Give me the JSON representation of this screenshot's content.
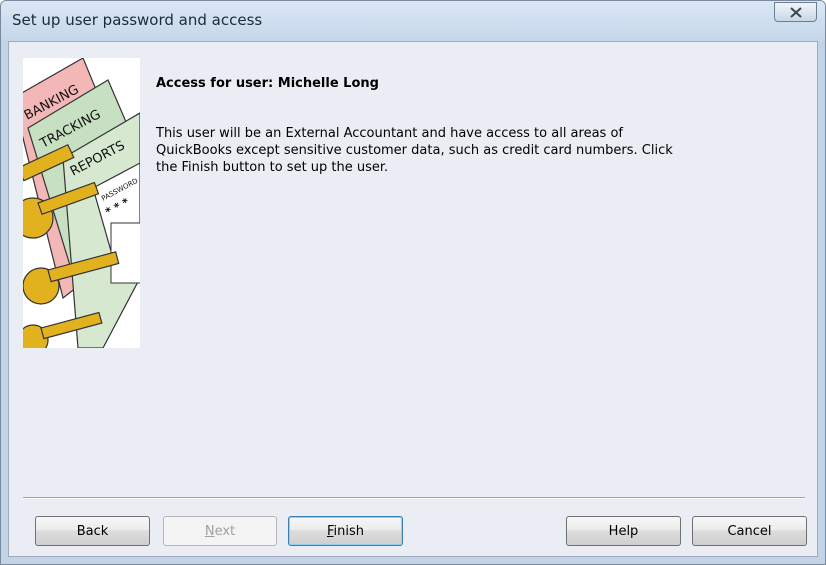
{
  "window": {
    "title": "Set up user password and access"
  },
  "content": {
    "heading": "Access for user: Michelle Long",
    "body": "This user will be an External Accountant and have access to all areas of QuickBooks except sensitive customer data, such as credit card numbers.  Click the Finish button to set up the user."
  },
  "illustration": {
    "labels": [
      "BANKING",
      "TRACKING",
      "REPORTS",
      "PASSWORD",
      "* * *"
    ],
    "colors": {
      "banking": "#f4b7b8",
      "tracking": "#c7e0c2",
      "reports": "#cfe2c9",
      "key": "#e2b21e"
    }
  },
  "buttons": {
    "back": {
      "mnemonic": "",
      "rest": "Back",
      "display": "Back"
    },
    "next": {
      "mnemonic": "N",
      "rest": "ext",
      "display": "Next"
    },
    "finish": {
      "mnemonic": "F",
      "rest": "inish",
      "display": "Finish"
    },
    "help": "Help",
    "cancel": "Cancel"
  }
}
